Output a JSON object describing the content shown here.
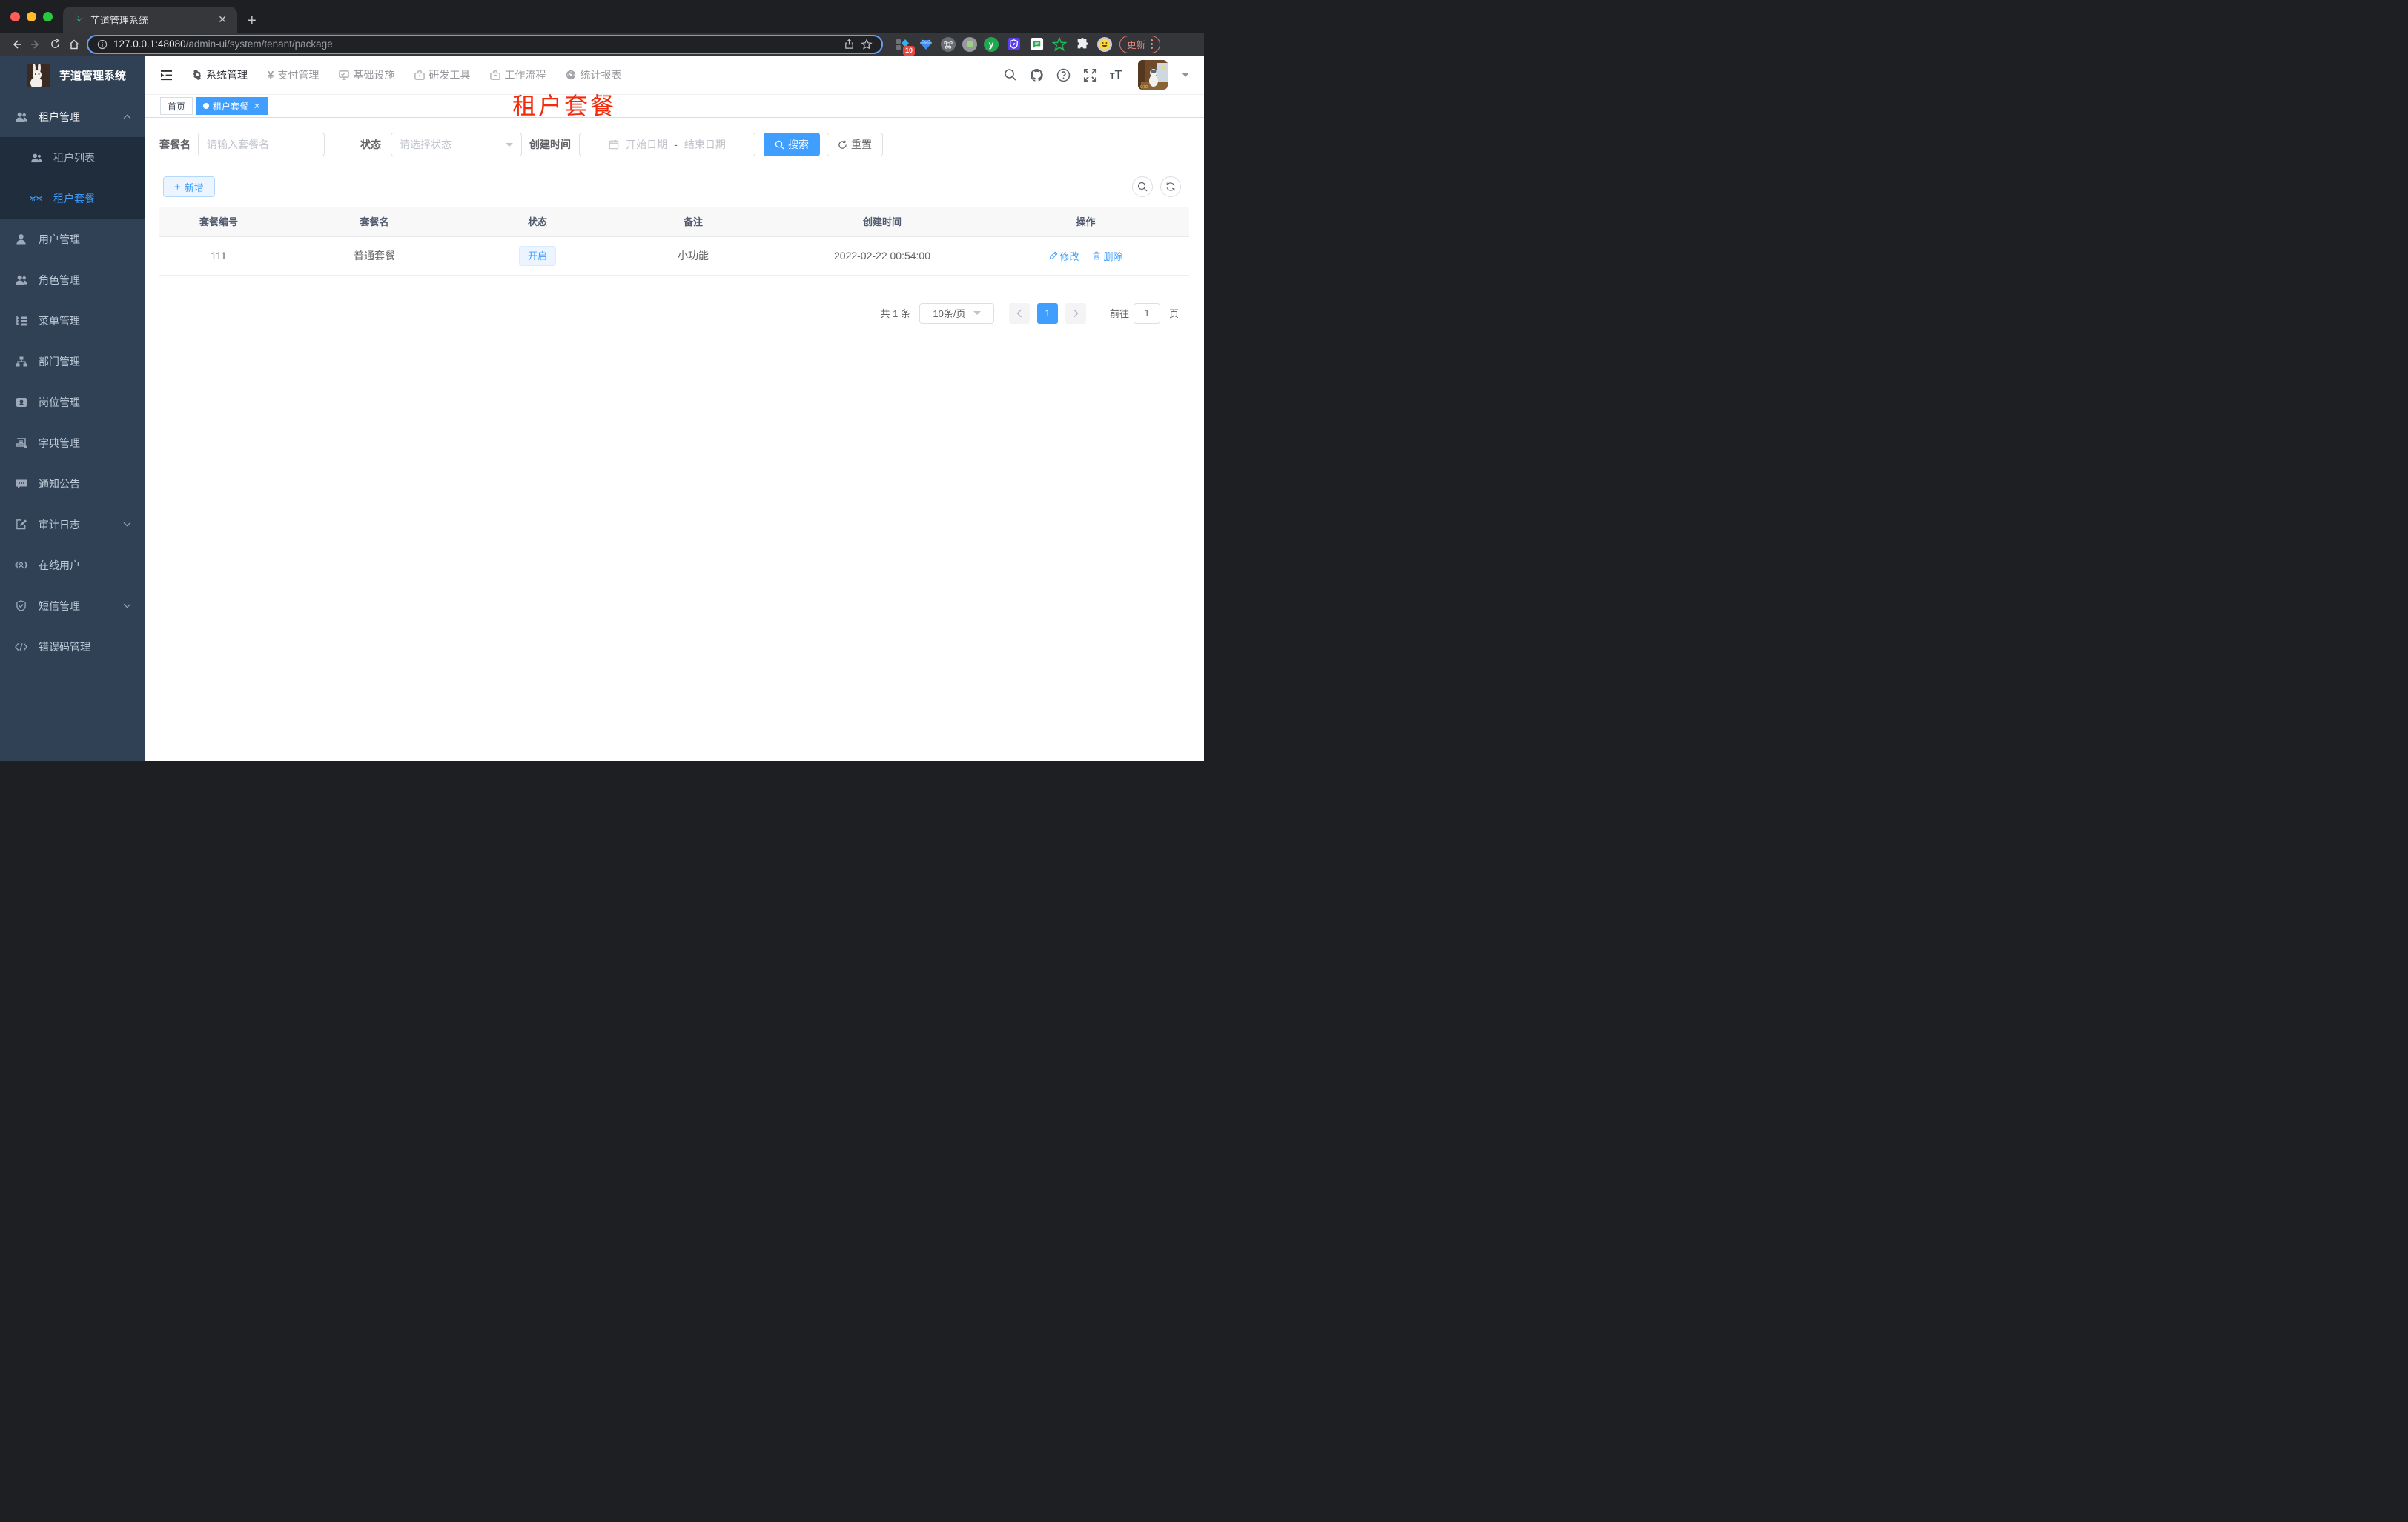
{
  "browser": {
    "tab_title": "芋道管理系统",
    "url_origin": "127.0.0.1:48080",
    "url_path": "/admin-ui/system/tenant/package",
    "ext_badge": "10",
    "update_label": "更新"
  },
  "sidebar": {
    "app_title": "芋道管理系统",
    "items": [
      {
        "label": "租户管理"
      },
      {
        "label": "租户列表"
      },
      {
        "label": "租户套餐"
      },
      {
        "label": "用户管理"
      },
      {
        "label": "角色管理"
      },
      {
        "label": "菜单管理"
      },
      {
        "label": "部门管理"
      },
      {
        "label": "岗位管理"
      },
      {
        "label": "字典管理"
      },
      {
        "label": "通知公告"
      },
      {
        "label": "审计日志"
      },
      {
        "label": "在线用户"
      },
      {
        "label": "短信管理"
      },
      {
        "label": "错误码管理"
      }
    ]
  },
  "topnav": {
    "items": [
      {
        "label": "系统管理"
      },
      {
        "label": "支付管理"
      },
      {
        "label": "基础设施"
      },
      {
        "label": "研发工具"
      },
      {
        "label": "工作流程"
      },
      {
        "label": "统计报表"
      }
    ]
  },
  "tags": {
    "home": "首页",
    "active": "租户套餐"
  },
  "page_title": "租户套餐",
  "search": {
    "name_label": "套餐名",
    "name_placeholder": "请输入套餐名",
    "status_label": "状态",
    "status_placeholder": "请选择状态",
    "date_label": "创建时间",
    "date_start": "开始日期",
    "date_sep": "-",
    "date_end": "结束日期",
    "search_btn": "搜索",
    "reset_btn": "重置"
  },
  "toolbar": {
    "add_btn": "新增"
  },
  "table": {
    "headers": [
      "套餐编号",
      "套餐名",
      "状态",
      "备注",
      "创建时间",
      "操作"
    ],
    "rows": [
      {
        "id": "111",
        "name": "普通套餐",
        "status": "开启",
        "remark": "小功能",
        "created": "2022-02-22 00:54:00"
      }
    ],
    "actions": {
      "edit": "修改",
      "delete": "删除"
    }
  },
  "pagination": {
    "total": "共 1 条",
    "size": "10条/页",
    "page": "1",
    "goto": "前往",
    "goto_value": "1",
    "unit": "页"
  },
  "colors": {
    "primary": "#409eff",
    "primary_light": "#ecf5ff",
    "sidebar_bg": "#304156",
    "submenu_bg": "#1f2d3d",
    "red_title": "#f5290c"
  }
}
